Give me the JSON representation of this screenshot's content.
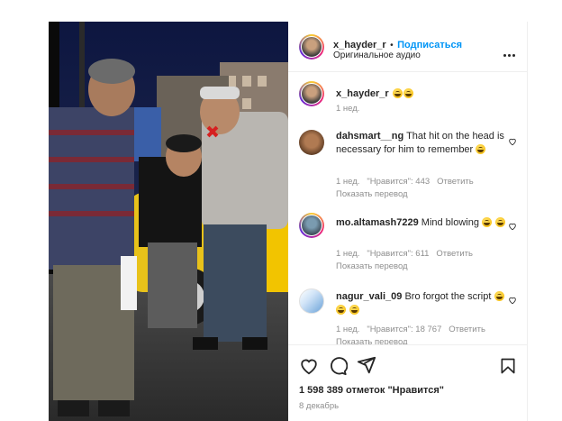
{
  "post": {
    "username": "x_hayder_r",
    "separator": "•",
    "follow_label": "Подписаться",
    "audio": "Оригинальное аудио",
    "more_label": "..."
  },
  "caption": {
    "username": "x_hayder_r",
    "time": "1 нед."
  },
  "comments": [
    {
      "username": "dahsmart__ng",
      "text": "That hit on the head is necessary for him to remember",
      "time": "1 нед.",
      "likes": "\"Нравится\": 443",
      "reply": "Ответить",
      "translate": "Показать перевод"
    },
    {
      "username": "mo.altamash7229",
      "text": "Mind blowing",
      "time": "1 нед.",
      "likes": "\"Нравится\": 611",
      "reply": "Ответить",
      "translate": "Показать перевод"
    },
    {
      "username": "nagur_vali_09",
      "text": "Bro forgot the script",
      "time": "1 нед.",
      "likes": "\"Нравится\": 18 767",
      "reply": "Ответить",
      "translate": "Показать перевод"
    }
  ],
  "footer": {
    "likes_text": "1 598 389 отметок \"Нравится\"",
    "date": "8 декабрь"
  },
  "icons": {
    "like": "heart-icon",
    "comment": "comment-icon",
    "share": "send-icon",
    "save": "bookmark-icon",
    "comment_like": "heart-outline-icon"
  },
  "colors": {
    "follow": "#0095f6",
    "muted": "#8e8e8e",
    "text": "#262626"
  }
}
